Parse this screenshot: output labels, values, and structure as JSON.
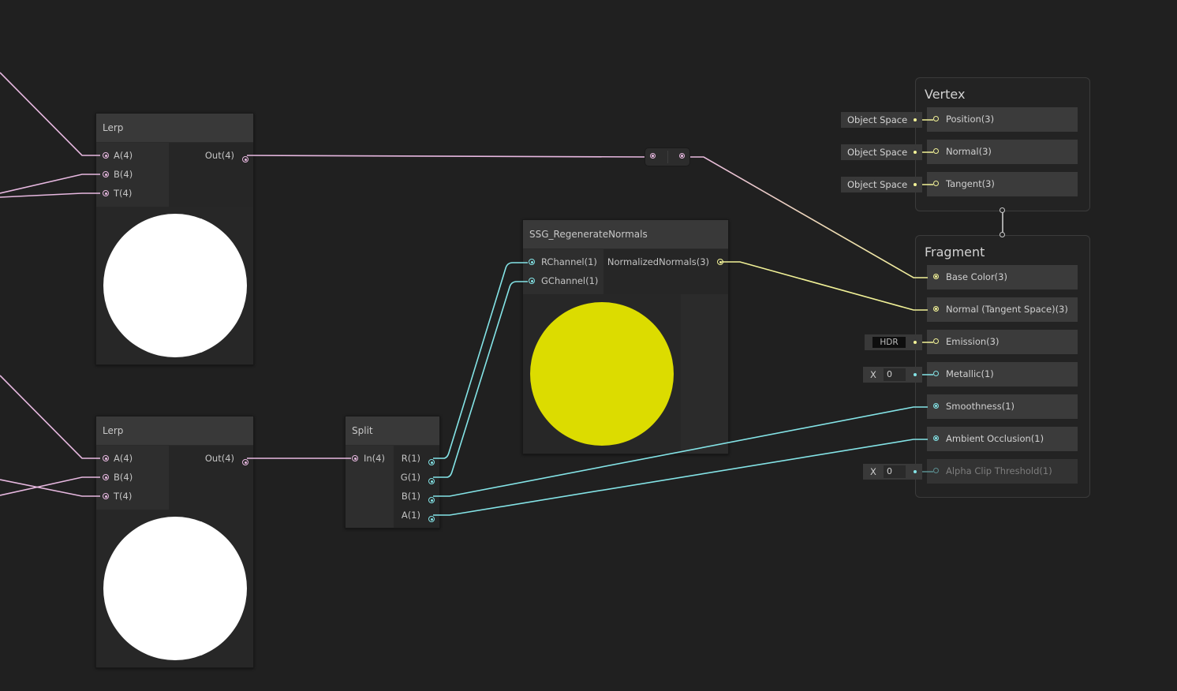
{
  "colors": {
    "vector4": "#e7b8e0",
    "vector3": "#f2f297",
    "vector1": "#84e4e7",
    "preview_white": "#ffffff",
    "preview_yellow": "#dcdc00"
  },
  "lerp_top": {
    "title": "Lerp",
    "inputs": [
      "A(4)",
      "B(4)",
      "T(4)"
    ],
    "output": "Out(4)"
  },
  "lerp_bottom": {
    "title": "Lerp",
    "inputs": [
      "A(4)",
      "B(4)",
      "T(4)"
    ],
    "output": "Out(4)"
  },
  "split": {
    "title": "Split",
    "input": "In(4)",
    "outputs": [
      "R(1)",
      "G(1)",
      "B(1)",
      "A(1)"
    ]
  },
  "regen": {
    "title": "SSG_RegenerateNormals",
    "inputs": [
      "RChannel(1)",
      "GChannel(1)"
    ],
    "output": "NormalizedNormals(3)"
  },
  "vertex": {
    "title": "Vertex",
    "blocks": [
      "Position(3)",
      "Normal(3)",
      "Tangent(3)"
    ],
    "space_labels": [
      "Object Space",
      "Object Space",
      "Object Space"
    ]
  },
  "fragment": {
    "title": "Fragment",
    "blocks": [
      "Base Color(3)",
      "Normal (Tangent Space)(3)",
      "Emission(3)",
      "Metallic(1)",
      "Smoothness(1)",
      "Ambient Occlusion(1)",
      "Alpha Clip Threshold(1)"
    ],
    "emission_field": "HDR",
    "metallic": {
      "label": "X",
      "value": "0"
    },
    "alpha_clip": {
      "label": "X",
      "value": "0"
    }
  }
}
